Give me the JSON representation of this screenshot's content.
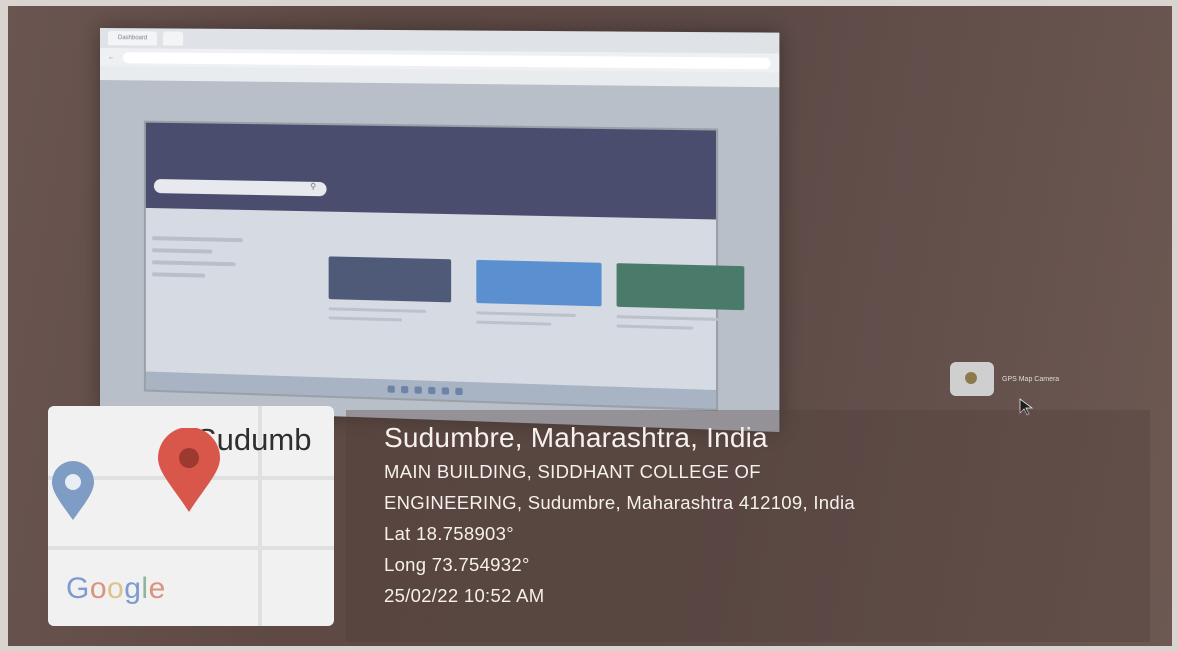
{
  "monitor": {
    "tabs": [
      "Dashboard",
      ""
    ],
    "url": "",
    "bookmarks": [
      "",
      "",
      "",
      "",
      "",
      ""
    ],
    "site": {
      "search_placeholder": "",
      "sidebar_heading": "",
      "cards": [
        {
          "title": "",
          "thumb_color": "#4f5a78"
        },
        {
          "title": "",
          "thumb_color": "#5a8fd0"
        },
        {
          "title": "",
          "thumb_color": "#4a7a6a"
        }
      ]
    }
  },
  "gps_app": {
    "icon": "gps-map-camera-icon",
    "label": "GPS Map Camera"
  },
  "map": {
    "place_label": "Sudumb",
    "logo_text": "Google",
    "red_pin_color": "#d9574a",
    "blue_pin_color": "#7e9cc4"
  },
  "location": {
    "title": "Sudumbre, Maharashtra, India",
    "address_line1": "MAIN BUILDING, SIDDHANT COLLEGE OF",
    "address_line2": "ENGINEERING, Sudumbre, Maharashtra 412109, India",
    "latitude": "Lat 18.758903°",
    "longitude": "Long 73.754932°",
    "timestamp": "25/02/22 10:52 AM"
  }
}
